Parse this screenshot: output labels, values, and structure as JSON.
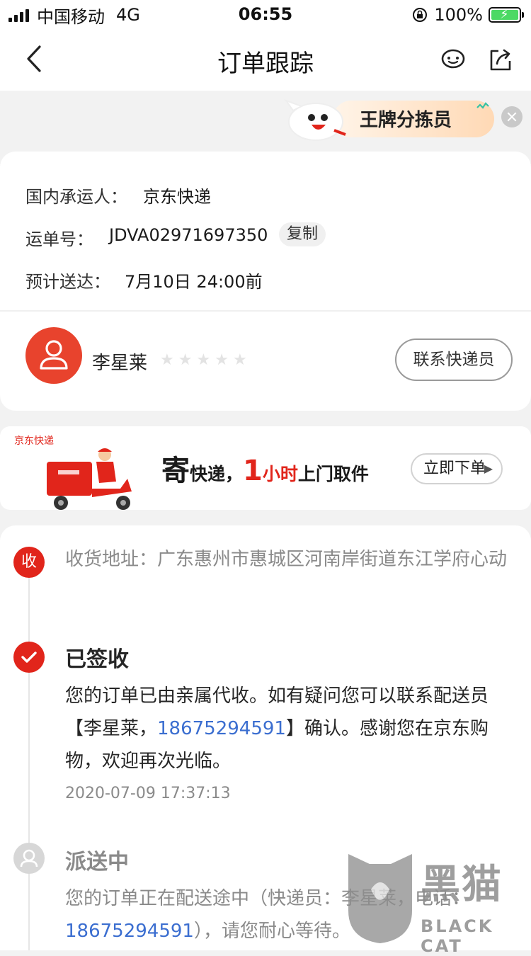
{
  "status_bar": {
    "carrier": "中国移动",
    "network": "4G",
    "time": "06:55",
    "battery": "100%"
  },
  "nav": {
    "title": "订单跟踪"
  },
  "badge": {
    "label": "王牌分拣员"
  },
  "shipment": {
    "carrier_label": "国内承运人：",
    "carrier_value": "京东快递",
    "waybill_label": "运单号：",
    "waybill_value": "JDVA02971697350",
    "copy_label": "复制",
    "eta_label": "预计送达：",
    "eta_value": "7月10日 24:00前"
  },
  "courier": {
    "name": "李星莱",
    "rating": 0,
    "max_rating": 5,
    "contact_label": "联系快递员"
  },
  "banner": {
    "logo": "京东快递",
    "send": "寄",
    "express": "快递，",
    "one": "1",
    "hour": "小时",
    "pickup": "上门取件",
    "cta": "立即下单"
  },
  "tracking": {
    "receive_icon": "收",
    "address_label": "收货地址：",
    "address": "广东惠州市惠城区河南岸街道东江学府心动",
    "signed_title": "已签收",
    "signed_desc_1": "您的订单已由亲属代收。如有疑问您可以联系配送员【李星莱，",
    "signed_phone": "18675294591",
    "signed_desc_2": "】确认。感谢您在京东购物，欢迎再次光临。",
    "signed_time": "2020-07-09 17:37:13",
    "delivery_title": "派送中",
    "delivery_desc_1": "您的订单正在配送途中（快递员：李星莱，电话：",
    "delivery_phone": "18675294591",
    "delivery_desc_2": "），请您耐心等待。"
  },
  "watermark": {
    "cn": "黑猫",
    "en": "BLACK CAT"
  },
  "colors": {
    "accent": "#e1251b",
    "link": "#3b6ed0"
  }
}
